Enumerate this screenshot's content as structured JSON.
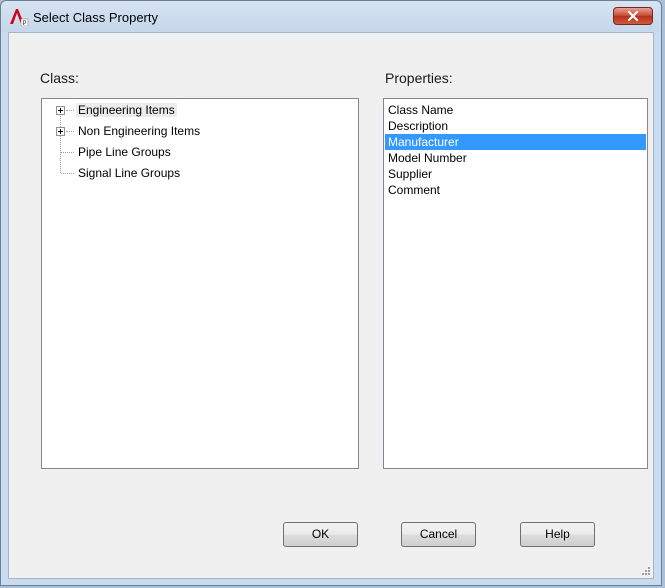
{
  "window": {
    "title": "Select Class Property"
  },
  "class_panel": {
    "label": "Class:",
    "items": [
      {
        "label": "Engineering Items",
        "expandable": true
      },
      {
        "label": "Non Engineering Items",
        "expandable": true
      },
      {
        "label": "Pipe Line Groups",
        "expandable": false
      },
      {
        "label": "Signal Line Groups",
        "expandable": false
      }
    ]
  },
  "properties_panel": {
    "label": "Properties:",
    "items": [
      "Class Name",
      "Description",
      "Manufacturer",
      "Model Number",
      "Supplier",
      "Comment"
    ],
    "selected": "Manufacturer"
  },
  "buttons": {
    "ok": "OK",
    "cancel": "Cancel",
    "help": "Help"
  },
  "colors": {
    "selection": "#3399ff",
    "close_button": "#c7452f",
    "app_icon": "#d0021b"
  }
}
